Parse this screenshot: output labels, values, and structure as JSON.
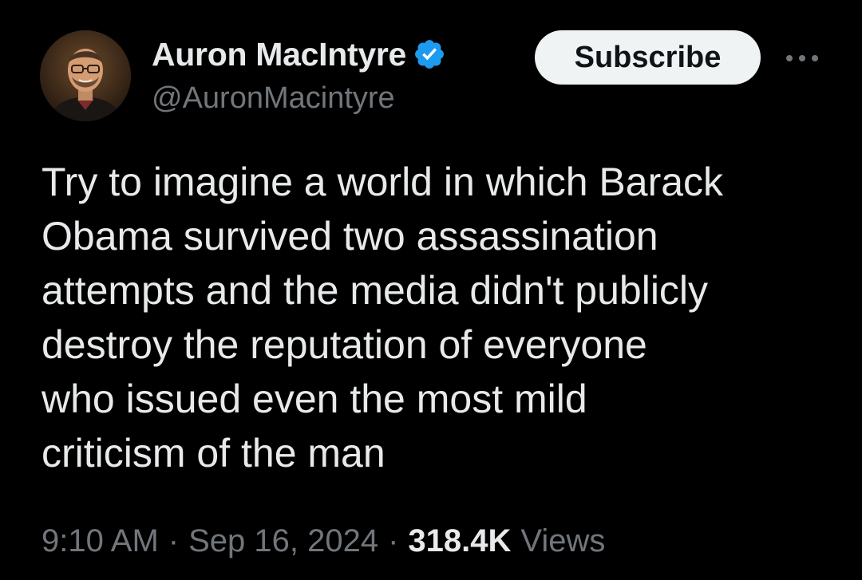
{
  "author": {
    "display_name": "Auron MacIntyre",
    "handle": "@AuronMacintyre",
    "verified_icon": "verified-badge-icon",
    "verified_color": "#1d9bf0",
    "avatar_icon": "profile-photo-avatar"
  },
  "actions": {
    "subscribe_label": "Subscribe",
    "more_icon": "more-options-icon"
  },
  "tweet": {
    "text": "Try to imagine a world in which Barack\nObama survived two assassination\nattempts and the media didn't publicly\ndestroy the reputation of everyone\nwho issued even the most mild\ncriticism of the man"
  },
  "meta": {
    "time": "9:10 AM",
    "separator": "·",
    "date": "Sep 16, 2024",
    "views_count": "318.4K",
    "views_label": "Views"
  },
  "colors": {
    "background": "#000000",
    "primary_text": "#e7e9ea",
    "secondary_text": "#71767b",
    "button_background": "#eff3f4"
  }
}
